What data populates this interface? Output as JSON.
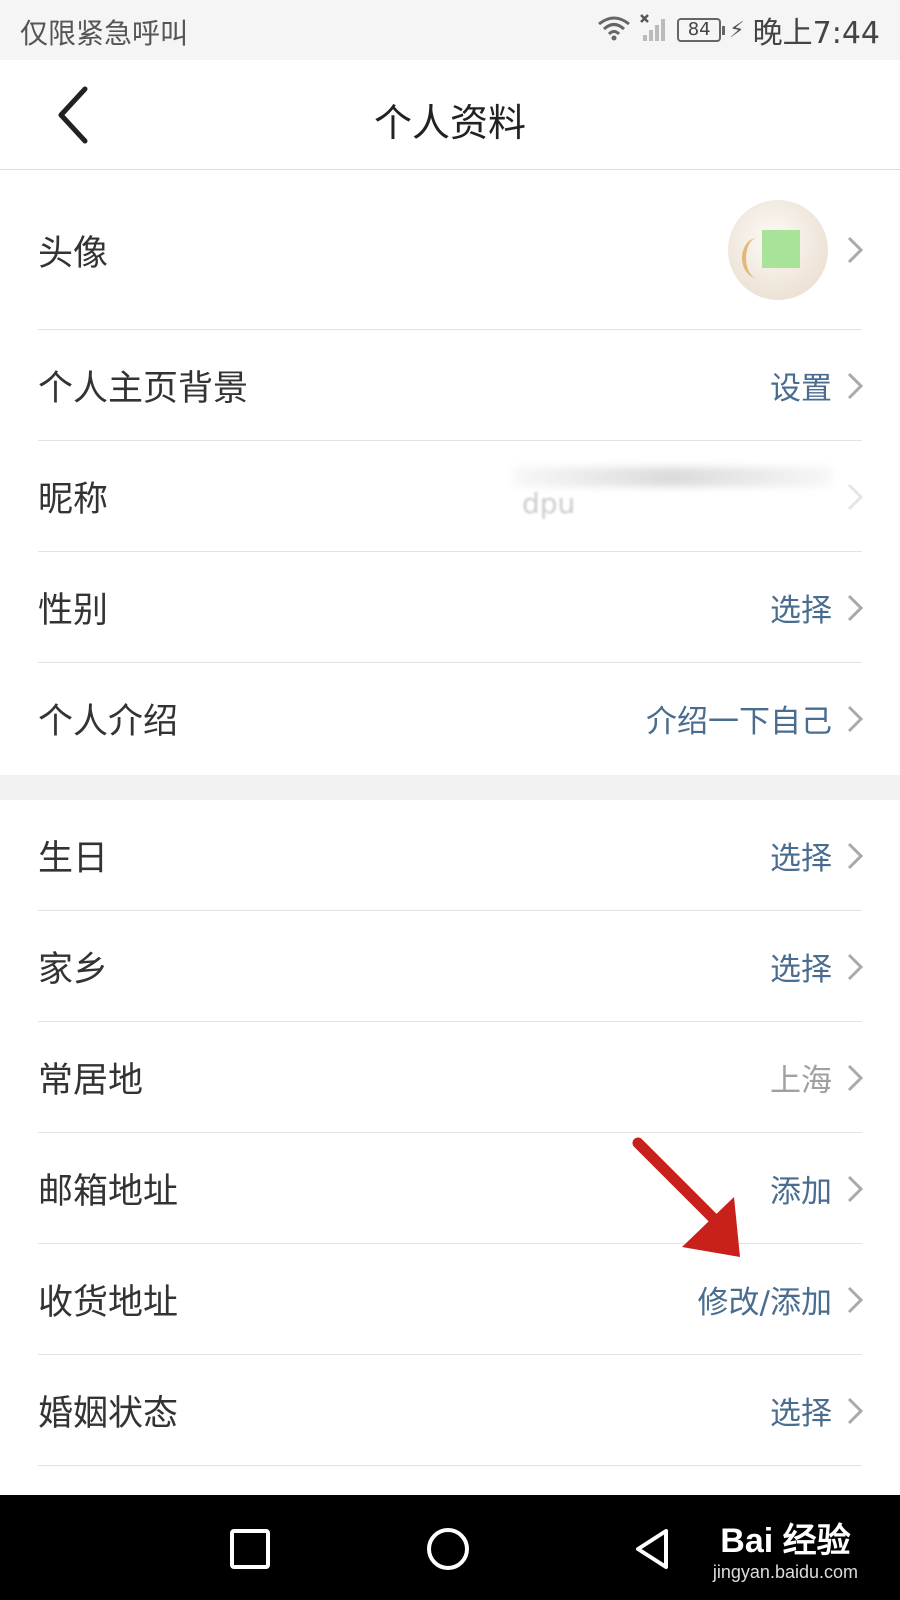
{
  "status_bar": {
    "carrier_text": "仅限紧急呼叫",
    "battery": "84",
    "time": "晚上7:44"
  },
  "header": {
    "title": "个人资料"
  },
  "section1": [
    {
      "label": "头像",
      "value": "",
      "type": "avatar"
    },
    {
      "label": "个人主页背景",
      "value": "设置"
    },
    {
      "label": "昵称",
      "value": "dpu",
      "type": "blurred"
    },
    {
      "label": "性别",
      "value": "选择"
    },
    {
      "label": "个人介绍",
      "value": "介绍一下自己"
    }
  ],
  "section2": [
    {
      "label": "生日",
      "value": "选择"
    },
    {
      "label": "家乡",
      "value": "选择"
    },
    {
      "label": "常居地",
      "value": "上海"
    },
    {
      "label": "邮箱地址",
      "value": "添加"
    },
    {
      "label": "收货地址",
      "value": "修改/添加"
    },
    {
      "label": "婚姻状态",
      "value": "选择"
    }
  ],
  "watermark": {
    "main": "Bai 经验",
    "sub": "jingyan.baidu.com"
  },
  "colors": {
    "link": "#4a6d8f",
    "muted": "#a0a0a0",
    "annotation": "#c8211b"
  }
}
